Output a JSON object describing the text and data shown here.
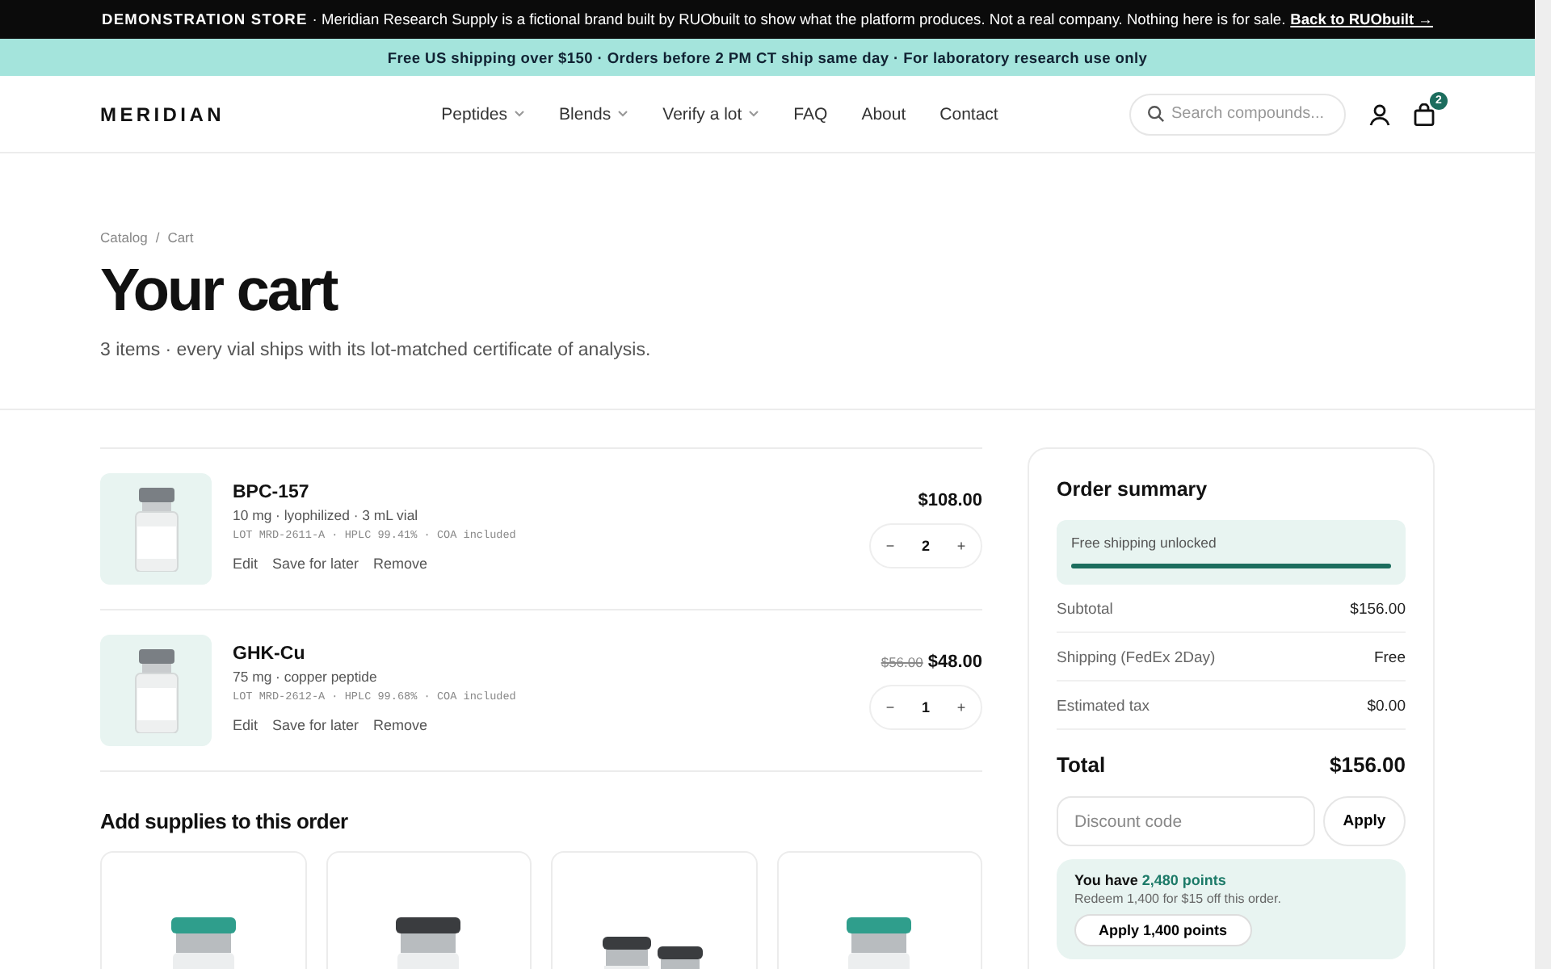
{
  "announcement": {
    "label": "DEMONSTRATION STORE",
    "text": "· Meridian Research Supply is a fictional brand built by RUObuilt to show what the platform produces. Not a real company. Nothing here is for sale.",
    "link": "Back to RUObuilt →"
  },
  "promo_bar": "Free US shipping over $150 · Orders before 2 PM CT ship same day · For laboratory research use only",
  "header": {
    "logo": "MERIDIAN",
    "nav": [
      {
        "label": "Peptides",
        "dropdown": true
      },
      {
        "label": "Blends",
        "dropdown": true
      },
      {
        "label": "Verify a lot",
        "dropdown": true
      },
      {
        "label": "FAQ",
        "dropdown": false
      },
      {
        "label": "About",
        "dropdown": false
      },
      {
        "label": "Contact",
        "dropdown": false
      }
    ],
    "search": {
      "placeholder": "Search compounds..."
    },
    "cart_count": "2"
  },
  "breadcrumb": {
    "items": [
      "Catalog",
      "Cart"
    ],
    "separator": "/"
  },
  "title": "Your cart",
  "subtitle": "3 items · every vial ships with its lot-matched certificate of analysis.",
  "cart_items": [
    {
      "name": "BPC-157",
      "meta": "10 mg · lyophilized · 3 mL vial",
      "lot": "LOT MRD-2611-A · HPLC 99.41% · COA included",
      "actions": [
        "Edit",
        "Save for later",
        "Remove"
      ],
      "price": "$108.00",
      "quantity": "2",
      "minus": "−",
      "plus": "+"
    },
    {
      "name": "GHK-Cu",
      "meta": "75 mg · copper peptide",
      "lot": "LOT MRD-2612-A · HPLC 99.68% · COA included",
      "actions": [
        "Edit",
        "Save for later",
        "Remove"
      ],
      "original_price": "$56.00",
      "price": "$48.00",
      "quantity": "1",
      "minus": "−",
      "plus": "+"
    }
  ],
  "upsell": {
    "title": "Add supplies to this order",
    "cards": [
      {
        "kind": "teal"
      },
      {
        "kind": "dark"
      },
      {
        "kind": "pair"
      },
      {
        "kind": "teal"
      }
    ]
  },
  "summary": {
    "title": "Order summary",
    "shipping_progress": {
      "label": "Free shipping unlocked",
      "level": 1
    },
    "lines": [
      {
        "label": "Subtotal",
        "value": "$156.00"
      },
      {
        "label": "Shipping (FedEx 2Day)",
        "value": "Free"
      },
      {
        "label": "Estimated tax",
        "value": "$0.00"
      }
    ],
    "total": {
      "label": "Total",
      "value": "$156.00"
    },
    "discount": {
      "placeholder": "Discount code",
      "button": "Apply"
    },
    "points": {
      "text": "You have **2,480 points**",
      "note": "Redeem 1,400 for $15 off this order.",
      "button": "Apply 1,400 points"
    }
  }
}
